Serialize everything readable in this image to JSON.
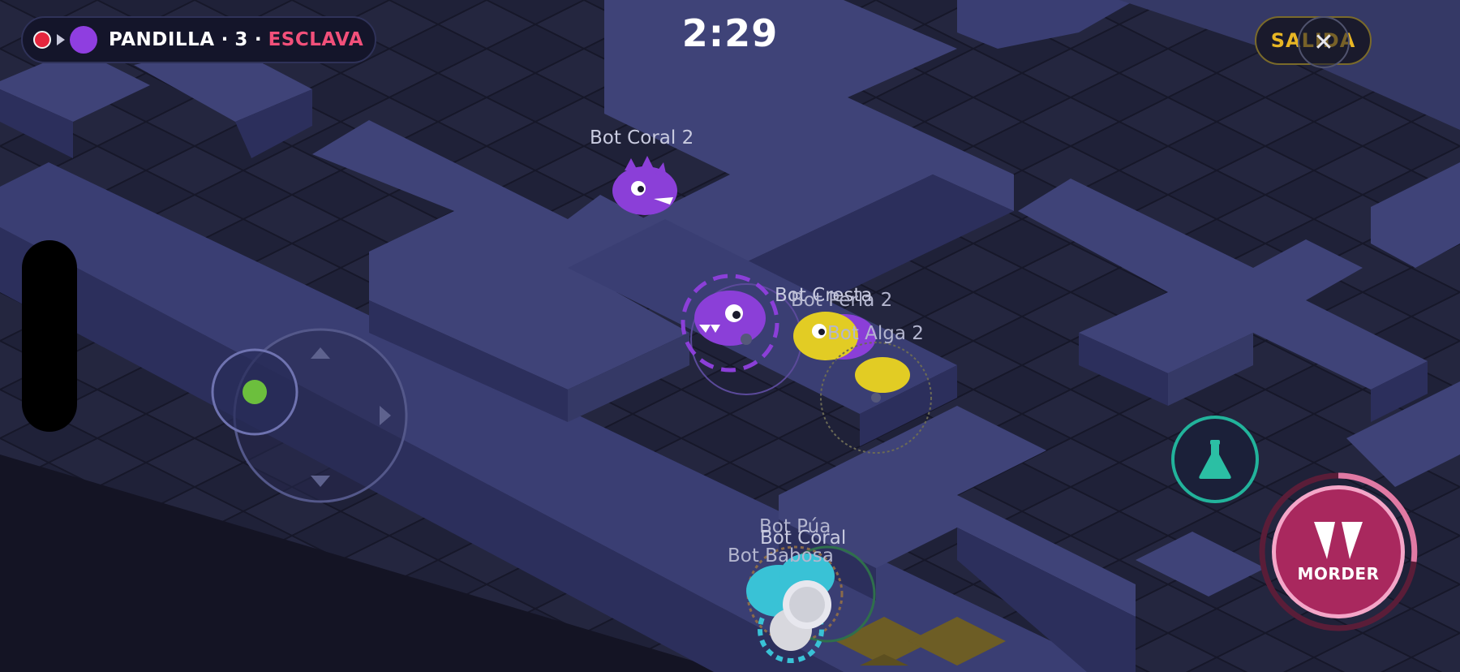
{
  "hud": {
    "team_label": "PANDILLA",
    "team_count": "3",
    "separator": "·",
    "role": "ESCLAVA",
    "team_color": "#8f3ee0",
    "role_color": "#f2507a"
  },
  "timer": "2:29",
  "exit_button": {
    "label": "SALIDA",
    "color": "#e8b624"
  },
  "close_icon": "close-icon",
  "bite_button": {
    "label": "MORDER",
    "icon": "fangs-icon",
    "color": "#a9285e"
  },
  "potion_button": {
    "icon": "flask-icon",
    "color": "#22b39b"
  },
  "joystick": {
    "icon": "dpad-arrows-icon",
    "knob_color": "#6cbf3d"
  },
  "players": {
    "bot_coral_2": "Bot Coral 2",
    "bot_cresta": "Bot Cresta",
    "bot_perla_2": "Bot Perla 2",
    "bot_alga_2": "Bot Alga 2",
    "bot_pua": "Bot Púa",
    "bot_coral": "Bot Coral",
    "bot_babosa": "Bot Babosa"
  }
}
